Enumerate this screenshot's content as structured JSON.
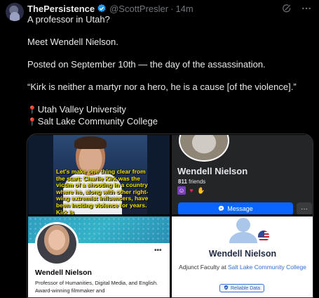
{
  "post": {
    "display_name": "ThePersistence",
    "handle": "@ScottPresler",
    "separator": "·",
    "time": "14m",
    "icons": [
      "verified-badge-icon",
      "grok-icon",
      "more-options-icon"
    ],
    "lines": [
      "A professor in Utah?",
      "",
      "Meet Wendell Nielson.",
      "",
      "Posted on September 10th — the day of the assassination.",
      "",
      "“Kirk is neither a martyr nor a hero, he is a cause [of the violence].”",
      ""
    ],
    "locations": [
      "Utah Valley University",
      "Salt Lake Community College"
    ]
  },
  "media": {
    "video_caption": "Let's make one thing clear from the start: Charlie Kirk was the victim of a shooting in a country where he, along with other right-wing extremist influencers, have been inciting violence for years. Kirk is",
    "facebook": {
      "name": "Wendell Nielson",
      "friends_count": "811",
      "friends_label": "friends",
      "message_button": "Message",
      "more_button": "···",
      "emojis": [
        "purple-face-emoji",
        "red-heart-emoji",
        "waving-hand-emoji"
      ]
    },
    "linkedin": {
      "name": "Wendell Nielson",
      "headline": "Professor of Humanities, Digital Media, and English. Award-winning filmmaker and",
      "more_button": "•••"
    },
    "faculty": {
      "name": "Wendell Nielson",
      "role_prefix": "Adjunct Faculty at",
      "institution": "Salt Lake Community College",
      "badge": "Reliable Data"
    }
  },
  "colors": {
    "background": "#000000",
    "text": "#e7e9ea",
    "muted": "#71767b",
    "verified": "#1d9bf0",
    "facebook_blue": "#0866ff",
    "link_blue": "#2f6fd6"
  }
}
